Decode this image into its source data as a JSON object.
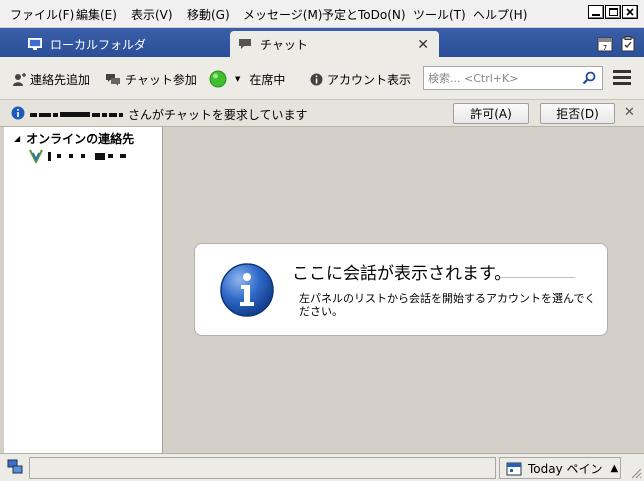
{
  "menubar": {
    "items": [
      "ファイル(F)",
      "編集(E)",
      "表示(V)",
      "移動(G)",
      "メッセージ(M)",
      "予定とToDo(N)",
      "ツール(T)",
      "ヘルプ(H)"
    ]
  },
  "tabs": [
    {
      "label": "ローカルフォルダ",
      "icon": "folder-monitor-icon"
    },
    {
      "label": "チャット",
      "icon": "chat-bubble-icon"
    }
  ],
  "toolbar": {
    "add_contact": "連絡先追加",
    "join_chat": "チャット参加",
    "status": "在席中",
    "show_accounts": "アカウント表示",
    "search_placeholder": "検索... <Ctrl+K>"
  },
  "notification": {
    "message": "さんがチャットを要求しています",
    "accept": "許可(A)",
    "decline": "拒否(D)"
  },
  "contacts": {
    "group_label": "オンラインの連絡先"
  },
  "conversation": {
    "title": "ここに会話が表示されます。",
    "body": "左パネルのリストから会話を開始するアカウントを選んでください。"
  },
  "statusbar": {
    "today_pane": "Today ペイン"
  },
  "colors": {
    "tabstrip": "#2a4f98",
    "status_online": "#3fbf2f",
    "info_blue": "#1e5bb8"
  }
}
